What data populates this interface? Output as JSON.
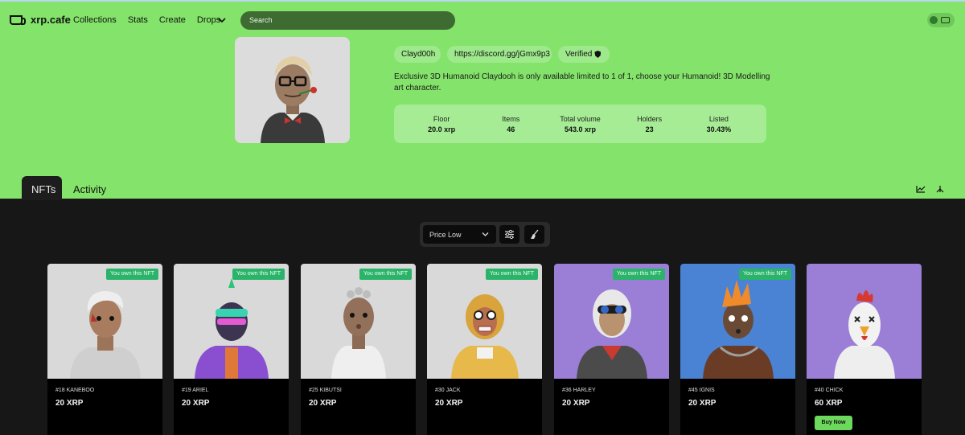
{
  "nav": {
    "logo": "xrp.cafe",
    "items": [
      "Collections",
      "Stats",
      "Create",
      "Drops"
    ],
    "search_placeholder": "Search"
  },
  "collection": {
    "creator": "Clayd00h",
    "discord": "https://discord.gg/jGmx9p3",
    "verified": "Verified",
    "description": "Exclusive 3D Humanoid Claydooh is only available limited to 1 of 1, choose your Humanoid! 3D Modelling art character."
  },
  "stats": [
    {
      "label": "Floor",
      "value": "20.0 xrp"
    },
    {
      "label": "Items",
      "value": "46"
    },
    {
      "label": "Total volume",
      "value": "543.0 xrp"
    },
    {
      "label": "Holders",
      "value": "23"
    },
    {
      "label": "Listed",
      "value": "30.43%"
    }
  ],
  "tabs": [
    "NFTs",
    "Activity"
  ],
  "toolbar": {
    "sort_value": "Price Low"
  },
  "cards": [
    {
      "name": "#18 KANEBOO",
      "price": "20 XRP",
      "badge": "You own this NFT",
      "bg": "#d9d9d9"
    },
    {
      "name": "#19 ARIEL",
      "price": "20 XRP",
      "badge": "You own this NFT",
      "bg": "#d9d9d9"
    },
    {
      "name": "#25 KIBUTSI",
      "price": "20 XRP",
      "badge": "You own this NFT",
      "bg": "#d9d9d9"
    },
    {
      "name": "#30 JACK",
      "price": "20 XRP",
      "badge": "You own this NFT",
      "bg": "#d9d9d9"
    },
    {
      "name": "#36 HARLEY",
      "price": "20 XRP",
      "badge": "You own this NFT",
      "bg": "#9b7fd6"
    },
    {
      "name": "#45 IGNIS",
      "price": "20 XRP",
      "badge": "You own this NFT",
      "bg": "#4a82d4"
    },
    {
      "name": "#40 CHICK",
      "price": "60 XRP",
      "buy": "Buy Now",
      "bg": "#9b7fd6"
    }
  ],
  "colors": {
    "hero": "#84e36a",
    "page": "#171717",
    "badge": "#2bb36a",
    "buy": "#6cd85c"
  }
}
